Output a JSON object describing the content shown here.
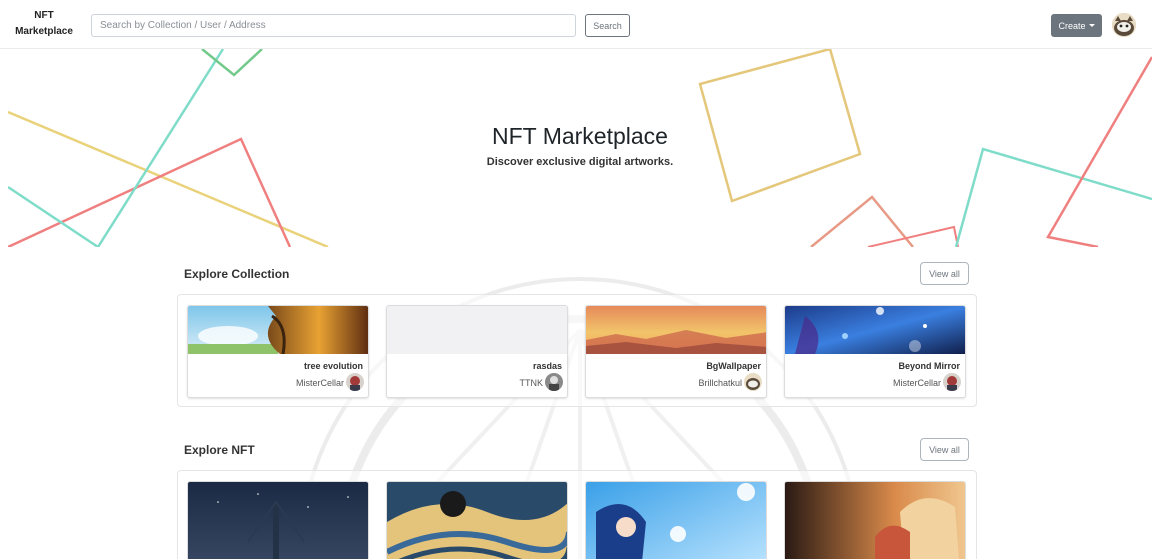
{
  "navbar": {
    "brand_line1": "NFT",
    "brand_line2": "Marketplace",
    "search_placeholder": "Search by Collection / User / Address",
    "search_label": "Search",
    "create_label": "Create"
  },
  "hero": {
    "title": "NFT Marketplace",
    "subtitle": "Discover exclusive digital artworks."
  },
  "collections": {
    "title": "Explore Collection",
    "view_all": "View all",
    "items": [
      {
        "name": "tree evolution",
        "owner": "MisterCellar"
      },
      {
        "name": "rasdas",
        "owner": "TTNK"
      },
      {
        "name": "BgWallpaper",
        "owner": "Brillchatkul"
      },
      {
        "name": "Beyond Mirror",
        "owner": "MisterCellar"
      }
    ]
  },
  "nfts": {
    "title": "Explore NFT",
    "view_all": "View all"
  },
  "colors": {
    "primary_button": "#6c757d",
    "line_red": "#f08080",
    "line_yellow": "#e9d27a",
    "line_teal": "#7fdcc9",
    "line_green": "#72c98a"
  }
}
